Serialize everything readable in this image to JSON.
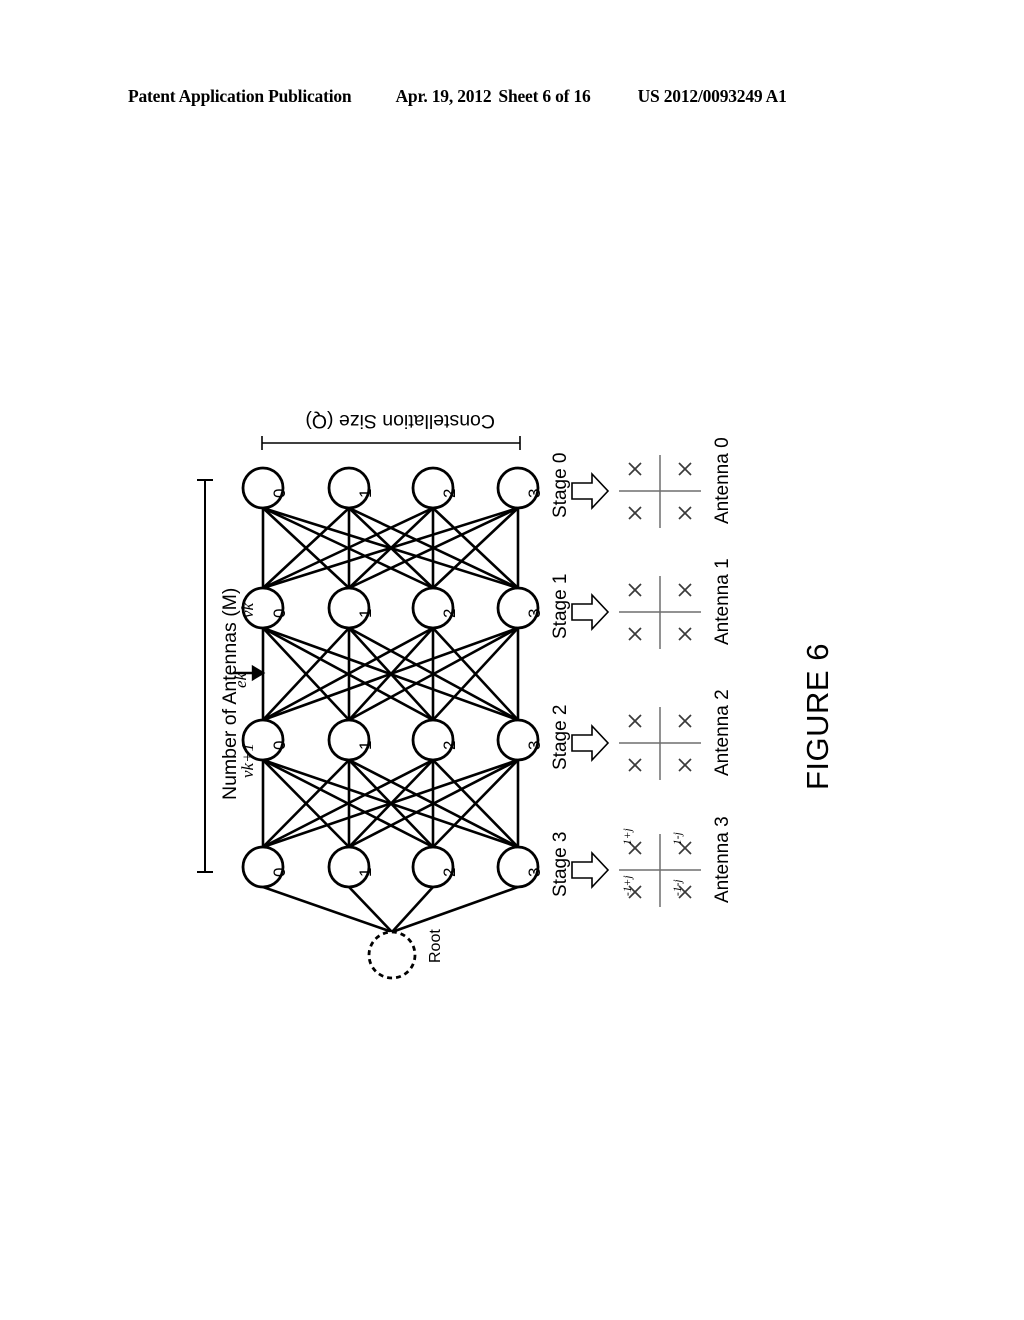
{
  "header": {
    "publication": "Patent Application Publication",
    "date": "Apr. 19, 2012",
    "sheet": "Sheet 6 of 16",
    "number": "US 2012/0093249 A1"
  },
  "figure": {
    "title": "FIGURE 6",
    "axis_labels": {
      "vertical_bracket": "Number of Antennas (M)",
      "horizontal_bracket": "Constellation Size (Q)"
    },
    "trellis": {
      "node_values": [
        "0",
        "1",
        "2",
        "3"
      ],
      "stages": [
        {
          "stage_label": "Stage 0",
          "antenna_label": "Antenna 0",
          "nodes": [
            "0",
            "1",
            "2",
            "3"
          ]
        },
        {
          "stage_label": "Stage 1",
          "antenna_label": "Antenna 1",
          "nodes": [
            "0",
            "1",
            "2",
            "3"
          ]
        },
        {
          "stage_label": "Stage 2",
          "antenna_label": "Antenna 2",
          "nodes": [
            "0",
            "1",
            "2",
            "3"
          ]
        },
        {
          "stage_label": "Stage 3",
          "antenna_label": "Antenna 3",
          "nodes": [
            "0",
            "1",
            "2",
            "3"
          ]
        }
      ],
      "root": {
        "label": "Root"
      },
      "edge_annotations": {
        "node_k": "vk",
        "edge_k": "ek",
        "node_k_plus_1": "vk+1"
      }
    },
    "constellations": [
      {
        "antenna": "Antenna 0",
        "points": [
          {
            "label": ""
          },
          {
            "label": ""
          },
          {
            "label": ""
          },
          {
            "label": ""
          }
        ]
      },
      {
        "antenna": "Antenna 1",
        "points": [
          {
            "label": ""
          },
          {
            "label": ""
          },
          {
            "label": ""
          },
          {
            "label": ""
          }
        ]
      },
      {
        "antenna": "Antenna 2",
        "points": [
          {
            "label": ""
          },
          {
            "label": ""
          },
          {
            "label": ""
          },
          {
            "label": ""
          }
        ]
      },
      {
        "antenna": "Antenna 3",
        "points": [
          {
            "label": "1+j"
          },
          {
            "label": "-1+j"
          },
          {
            "label": "1-j"
          },
          {
            "label": "-1-j"
          }
        ]
      }
    ]
  },
  "colors": {
    "ink": "#000000",
    "paper": "#ffffff",
    "light_rule": "#8a8a8a"
  }
}
